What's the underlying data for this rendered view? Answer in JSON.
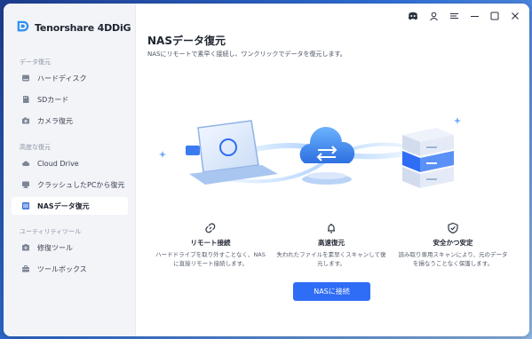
{
  "app": {
    "brand_name": "Tenorshare 4DDiG"
  },
  "sidebar": {
    "sections": [
      {
        "label": "データ復元"
      },
      {
        "label": "高度な復元"
      },
      {
        "label": "ユーティリティツール"
      }
    ],
    "items": [
      {
        "label": "ハードディスク",
        "icon": "hard-disk-icon"
      },
      {
        "label": "SDカード",
        "icon": "sd-card-icon"
      },
      {
        "label": "カメラ復元",
        "icon": "camera-icon"
      },
      {
        "label": "Cloud Drive",
        "icon": "cloud-icon"
      },
      {
        "label": "クラッシュしたPCから復元",
        "icon": "crashed-pc-icon"
      },
      {
        "label": "NASデータ復元",
        "icon": "nas-icon",
        "active": true
      },
      {
        "label": "修復ツール",
        "icon": "repair-icon"
      },
      {
        "label": "ツールボックス",
        "icon": "toolbox-icon"
      }
    ]
  },
  "main": {
    "title": "NASデータ復元",
    "subtitle": "NASにリモートで素早く接続し、ワンクリックでデータを復元します。",
    "features": [
      {
        "title": "リモート接続",
        "desc_line1": "ハードドライブを取り外すことなく、NAS",
        "desc_line2": "に直接リモート接続します。",
        "icon": "link-icon"
      },
      {
        "title": "高速復元",
        "desc_line1": "失われたファイルを素早くスキャンして復",
        "desc_line2": "元します。",
        "icon": "bell-icon"
      },
      {
        "title": "安全かつ安定",
        "desc_line1": "読み取り専用スキャンにより、元のデータ",
        "desc_line2": "を損なうことなく保護します。",
        "icon": "shield-check-icon"
      }
    ],
    "connect_button": "NASに接続"
  },
  "titlebar": {
    "icons": [
      "discord-icon",
      "user-icon",
      "menu-icon",
      "minimize-icon",
      "maximize-icon",
      "close-icon"
    ]
  },
  "colors": {
    "accent": "#2f6df6",
    "sidebar_bg": "#f2f4f8"
  }
}
